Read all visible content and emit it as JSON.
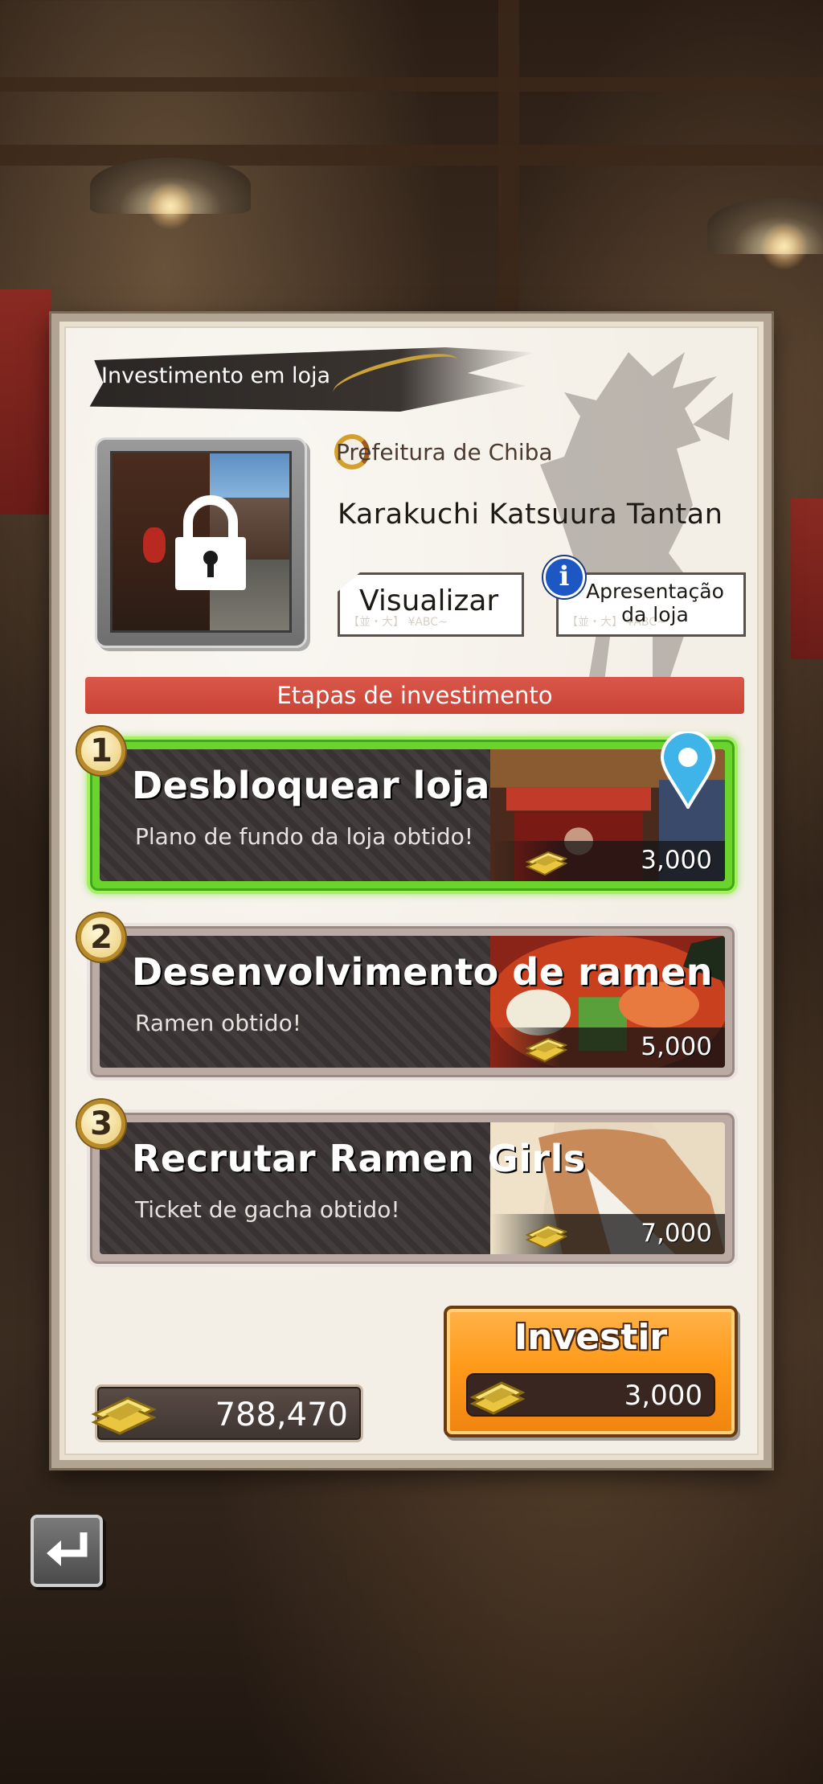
{
  "header": {
    "title": "Investimento em loja"
  },
  "shop": {
    "prefecture": "Prefeitura de Chiba",
    "name": "Karakuchi Katsuura Tantan",
    "view_button": "Visualizar",
    "intro_button_line1": "Apresentação",
    "intro_button_line2": "da loja",
    "ghost_text": "【並・大】 ¥ABC~"
  },
  "section": {
    "title": "Etapas de investimento"
  },
  "steps": [
    {
      "number": "1",
      "title": "Desbloquear loja",
      "subtitle": "Plano de fundo da loja obtido!",
      "price": "3,000",
      "active": true
    },
    {
      "number": "2",
      "title": "Desenvolvimento de ramen",
      "subtitle": "Ramen obtido!",
      "price": "5,000",
      "active": false
    },
    {
      "number": "3",
      "title": "Recrutar Ramen Girls",
      "subtitle": "Ticket de gacha obtido!",
      "price": "7,000",
      "active": false
    }
  ],
  "invest": {
    "label": "Investir",
    "cost": "3,000"
  },
  "balance": {
    "value": "788,470"
  },
  "colors": {
    "active_step": "#6ad42c",
    "invest_button": "#ff9a1a",
    "banner": "#d9574a"
  },
  "icons": [
    "lock-icon",
    "info-icon",
    "map-pin-icon",
    "money-stack-icon",
    "back-arrow-icon"
  ]
}
